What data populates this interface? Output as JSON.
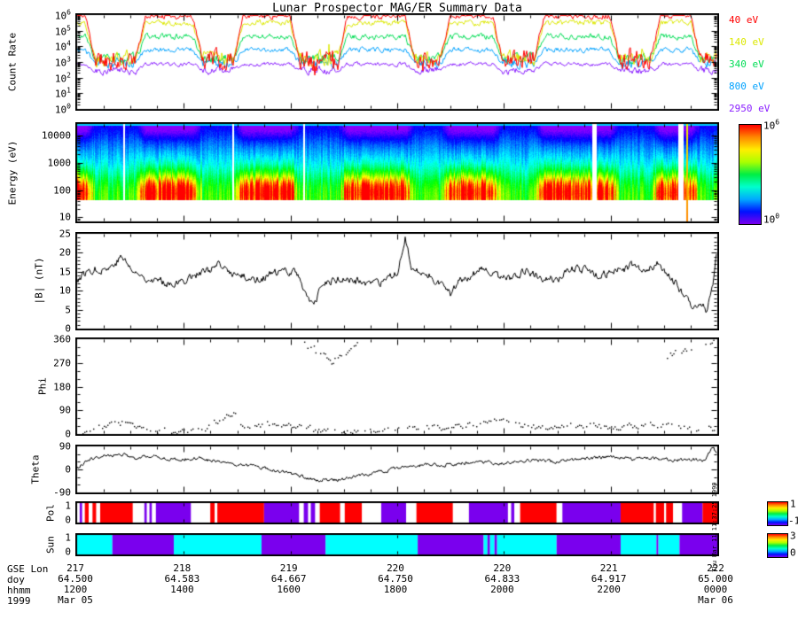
{
  "title": "Lunar Prospector MAG/ER Summary Data",
  "created_label": "Thu Mar 11 11:37:25 1999",
  "chart_data": {
    "type": "multi-panel time-series: log line plot, energy spectrogram (heatmap), line, scatter, line, categorical color bars",
    "time_axis": {
      "span": "1200 Mar 05 1999 to 0000 Mar 06 1999, major ticks every 2 hours",
      "tick_rows": [
        {
          "label": "GSE Lon",
          "values": [
            "217",
            "218",
            "219",
            "220",
            "220",
            "221",
            "222"
          ]
        },
        {
          "label": "doy",
          "values": [
            "64.500",
            "64.583",
            "64.667",
            "64.750",
            "64.833",
            "64.917",
            "65.000"
          ]
        },
        {
          "label": "hhmm",
          "values": [
            "1200",
            "1400",
            "1600",
            "1800",
            "2000",
            "2200",
            "0000"
          ]
        },
        {
          "label": "1999",
          "values": [
            "Mar 05",
            "",
            "",
            "",
            "",
            "",
            "Mar 06"
          ]
        }
      ]
    },
    "panels": [
      {
        "name": "count_rate",
        "ylabel": "Count Rate",
        "scale": "log",
        "ylim_log10": [
          0,
          6
        ],
        "ytick_labels": [
          "10^0",
          "10^1",
          "10^2",
          "10^3",
          "10^4",
          "10^5",
          "10^6"
        ],
        "dips": [
          [
            0.028,
            0.092
          ],
          [
            0.196,
            0.245
          ],
          [
            0.348,
            0.408
          ],
          [
            0.528,
            0.568
          ],
          [
            0.665,
            0.715
          ],
          [
            0.848,
            0.898
          ],
          [
            0.975,
            1.01
          ]
        ],
        "series": [
          {
            "label": "40 eV",
            "color": "#ff0000",
            "plateau_log10": 5.95,
            "dip_log10": 3.15,
            "noise": 0.16,
            "noise_dip": 0.5,
            "spiky": true,
            "seed": 11
          },
          {
            "label": "140 eV",
            "color": "#dce800",
            "plateau_log10": 5.5,
            "dip_log10": 3.25,
            "noise": 0.15,
            "noise_dip": 0.34,
            "spiky": true,
            "seed": 22
          },
          {
            "label": "340 eV",
            "color": "#00dd55",
            "plateau_log10": 4.62,
            "dip_log10": 3.2,
            "noise": 0.15,
            "noise_dip": 0.26,
            "spiky": false,
            "seed": 33
          },
          {
            "label": "800 eV",
            "color": "#00a2ff",
            "plateau_log10": 3.78,
            "dip_log10": 2.95,
            "noise": 0.13,
            "noise_dip": 0.26,
            "spiky": false,
            "seed": 44
          },
          {
            "label": "2950 eV",
            "color": "#8a1fff",
            "plateau_log10": 2.87,
            "dip_log10": 2.45,
            "noise": 0.1,
            "noise_dip": 0.2,
            "spiky": false,
            "seed": 55
          }
        ]
      },
      {
        "name": "energy_spectrogram",
        "ylabel": "Energy (eV)",
        "scale": "log",
        "ylim_log10": [
          0.85,
          4.42
        ],
        "ytick_labels": [
          "10000",
          "1000",
          "100",
          "10"
        ],
        "ytick_log10": [
          4,
          3,
          2,
          1
        ],
        "flux_peak_log10_energy": 1.95,
        "low_energy_cutoff_log10": 1.62,
        "white_gaps": [
          [
            0.072,
            2
          ],
          [
            0.243,
            2
          ],
          [
            0.354,
            2
          ],
          [
            0.806,
            5
          ],
          [
            0.941,
            6
          ]
        ],
        "yellow_line_t": 0.953,
        "colorbar": {
          "top_label": "10^6",
          "bottom_label": "10^0"
        },
        "seed": 7
      },
      {
        "name": "b_magnitude",
        "ylabel": "|B| (nT)",
        "ylim": [
          0,
          25
        ],
        "ytick_labels": [
          "0",
          "5",
          "10",
          "15",
          "20",
          "25"
        ],
        "noise": 0.9,
        "seed": 77,
        "points": [
          [
            0,
            13
          ],
          [
            0.02,
            15.5
          ],
          [
            0.05,
            16
          ],
          [
            0.07,
            19
          ],
          [
            0.09,
            14.5
          ],
          [
            0.11,
            13.5
          ],
          [
            0.13,
            12.5
          ],
          [
            0.16,
            12
          ],
          [
            0.18,
            14
          ],
          [
            0.2,
            15
          ],
          [
            0.22,
            16.5
          ],
          [
            0.25,
            14
          ],
          [
            0.28,
            13
          ],
          [
            0.31,
            14.5
          ],
          [
            0.34,
            15.5
          ],
          [
            0.36,
            9
          ],
          [
            0.37,
            5.5
          ],
          [
            0.385,
            12
          ],
          [
            0.41,
            13
          ],
          [
            0.44,
            12.5
          ],
          [
            0.46,
            11.5
          ],
          [
            0.48,
            12
          ],
          [
            0.5,
            14.5
          ],
          [
            0.513,
            24.5
          ],
          [
            0.525,
            15
          ],
          [
            0.55,
            14
          ],
          [
            0.57,
            12
          ],
          [
            0.585,
            8.5
          ],
          [
            0.6,
            13
          ],
          [
            0.63,
            15.5
          ],
          [
            0.65,
            14
          ],
          [
            0.68,
            13
          ],
          [
            0.7,
            15.5
          ],
          [
            0.72,
            14
          ],
          [
            0.75,
            13
          ],
          [
            0.78,
            16
          ],
          [
            0.8,
            15
          ],
          [
            0.82,
            14
          ],
          [
            0.85,
            15.5
          ],
          [
            0.87,
            16.5
          ],
          [
            0.89,
            15
          ],
          [
            0.91,
            17.5
          ],
          [
            0.93,
            13
          ],
          [
            0.95,
            9
          ],
          [
            0.965,
            5
          ],
          [
            0.975,
            7.5
          ],
          [
            0.985,
            4.5
          ],
          [
            0.995,
            13
          ],
          [
            1,
            20
          ]
        ]
      },
      {
        "name": "phi",
        "ylabel": "Phi",
        "ylim": [
          0,
          360
        ],
        "ytick_labels": [
          "0",
          "90",
          "180",
          "270",
          "360"
        ],
        "dot_noise": 10,
        "seed": 99,
        "low_band": [
          [
            0,
            15
          ],
          [
            0.04,
            30
          ],
          [
            0.07,
            45
          ],
          [
            0.1,
            20
          ],
          [
            0.15,
            10
          ],
          [
            0.2,
            15
          ],
          [
            0.243,
            88
          ],
          [
            0.26,
            25
          ],
          [
            0.29,
            30
          ],
          [
            0.32,
            45
          ],
          [
            0.35,
            30
          ],
          [
            0.38,
            12
          ],
          [
            0.42,
            10
          ],
          [
            0.46,
            15
          ],
          [
            0.5,
            20
          ],
          [
            0.55,
            25
          ],
          [
            0.6,
            30
          ],
          [
            0.64,
            55
          ],
          [
            0.68,
            40
          ],
          [
            0.72,
            25
          ],
          [
            0.76,
            30
          ],
          [
            0.8,
            35
          ],
          [
            0.84,
            25
          ],
          [
            0.88,
            30
          ],
          [
            0.92,
            35
          ],
          [
            0.96,
            25
          ],
          [
            1,
            15
          ]
        ],
        "clusters": [
          {
            "spread": 12,
            "points": [
              [
                0.355,
                345
              ],
              [
                0.368,
                330
              ],
              [
                0.382,
                305
              ],
              [
                0.398,
                278
              ],
              [
                0.415,
                295
              ],
              [
                0.428,
                330
              ],
              [
                0.44,
                352
              ]
            ]
          },
          {
            "spread": 16,
            "points": [
              [
                0.915,
                295
              ],
              [
                0.935,
                310
              ],
              [
                0.955,
                325
              ],
              [
                0.975,
                340
              ],
              [
                0.995,
                355
              ]
            ]
          }
        ]
      },
      {
        "name": "theta",
        "ylabel": "Theta",
        "ylim": [
          -90,
          90
        ],
        "ytick_labels": [
          "-90",
          "0",
          "90"
        ],
        "noise": 6,
        "seed": 120,
        "points": [
          [
            0,
            5
          ],
          [
            0.02,
            40
          ],
          [
            0.05,
            55
          ],
          [
            0.07,
            60
          ],
          [
            0.09,
            45
          ],
          [
            0.11,
            50
          ],
          [
            0.13,
            45
          ],
          [
            0.16,
            40
          ],
          [
            0.19,
            45
          ],
          [
            0.22,
            30
          ],
          [
            0.25,
            20
          ],
          [
            0.28,
            10
          ],
          [
            0.31,
            -5
          ],
          [
            0.34,
            -20
          ],
          [
            0.37,
            -40
          ],
          [
            0.4,
            -45
          ],
          [
            0.43,
            -30
          ],
          [
            0.46,
            -15
          ],
          [
            0.49,
            0
          ],
          [
            0.52,
            10
          ],
          [
            0.55,
            20
          ],
          [
            0.57,
            15
          ],
          [
            0.6,
            25
          ],
          [
            0.63,
            30
          ],
          [
            0.66,
            20
          ],
          [
            0.69,
            30
          ],
          [
            0.72,
            35
          ],
          [
            0.75,
            30
          ],
          [
            0.78,
            40
          ],
          [
            0.81,
            45
          ],
          [
            0.84,
            50
          ],
          [
            0.87,
            40
          ],
          [
            0.9,
            45
          ],
          [
            0.93,
            35
          ],
          [
            0.96,
            40
          ],
          [
            0.98,
            35
          ],
          [
            0.995,
            85
          ],
          [
            1,
            60
          ]
        ]
      },
      {
        "name": "pol",
        "ylabel": "Pol",
        "ytick_labels": [
          "0",
          "1"
        ],
        "colorbar": {
          "top_label": "1",
          "bottom_label": "-1"
        },
        "colors": {
          "R": "#ff0000",
          "P": "#7a00ee",
          "W": "#ffffff"
        },
        "segments": [
          [
            0,
            0.004,
            "W"
          ],
          [
            0.004,
            0.008,
            "P"
          ],
          [
            0.008,
            0.012,
            "W"
          ],
          [
            0.012,
            0.018,
            "R"
          ],
          [
            0.018,
            0.024,
            "W"
          ],
          [
            0.024,
            0.03,
            "R"
          ],
          [
            0.03,
            0.036,
            "W"
          ],
          [
            0.036,
            0.087,
            "R"
          ],
          [
            0.087,
            0.105,
            "W"
          ],
          [
            0.105,
            0.109,
            "P"
          ],
          [
            0.109,
            0.113,
            "W"
          ],
          [
            0.113,
            0.117,
            "P"
          ],
          [
            0.117,
            0.123,
            "W"
          ],
          [
            0.123,
            0.178,
            "P"
          ],
          [
            0.178,
            0.208,
            "W"
          ],
          [
            0.208,
            0.215,
            "R"
          ],
          [
            0.215,
            0.219,
            "W"
          ],
          [
            0.219,
            0.292,
            "R"
          ],
          [
            0.292,
            0.347,
            "P"
          ],
          [
            0.347,
            0.354,
            "W"
          ],
          [
            0.354,
            0.361,
            "P"
          ],
          [
            0.361,
            0.365,
            "W"
          ],
          [
            0.365,
            0.372,
            "P"
          ],
          [
            0.372,
            0.379,
            "W"
          ],
          [
            0.379,
            0.411,
            "R"
          ],
          [
            0.411,
            0.418,
            "W"
          ],
          [
            0.418,
            0.445,
            "R"
          ],
          [
            0.445,
            0.475,
            "W"
          ],
          [
            0.475,
            0.514,
            "P"
          ],
          [
            0.514,
            0.53,
            "W"
          ],
          [
            0.53,
            0.587,
            "R"
          ],
          [
            0.587,
            0.612,
            "W"
          ],
          [
            0.612,
            0.673,
            "P"
          ],
          [
            0.673,
            0.678,
            "W"
          ],
          [
            0.678,
            0.683,
            "P"
          ],
          [
            0.683,
            0.692,
            "W"
          ],
          [
            0.692,
            0.749,
            "R"
          ],
          [
            0.749,
            0.758,
            "W"
          ],
          [
            0.758,
            0.849,
            "P"
          ],
          [
            0.849,
            0.901,
            "R"
          ],
          [
            0.901,
            0.904,
            "W"
          ],
          [
            0.904,
            0.917,
            "R"
          ],
          [
            0.917,
            0.92,
            "W"
          ],
          [
            0.92,
            0.931,
            "R"
          ],
          [
            0.931,
            0.945,
            "W"
          ],
          [
            0.945,
            0.977,
            "P"
          ],
          [
            0.977,
            1,
            "R"
          ]
        ]
      },
      {
        "name": "sun",
        "ylabel": "Sun",
        "ytick_labels": [
          "0",
          "1"
        ],
        "colorbar": {
          "top_label": "3",
          "bottom_label": "0"
        },
        "colors": {
          "C": "#00ffff",
          "P": "#7a00ee"
        },
        "segments": [
          [
            0,
            0.055,
            "C"
          ],
          [
            0.055,
            0.151,
            "P"
          ],
          [
            0.151,
            0.288,
            "C"
          ],
          [
            0.288,
            0.388,
            "P"
          ],
          [
            0.388,
            0.532,
            "C"
          ],
          [
            0.532,
            0.635,
            "P"
          ],
          [
            0.635,
            0.641,
            "C"
          ],
          [
            0.641,
            0.645,
            "P"
          ],
          [
            0.645,
            0.652,
            "C"
          ],
          [
            0.652,
            0.656,
            "P"
          ],
          [
            0.656,
            0.749,
            "C"
          ],
          [
            0.749,
            0.849,
            "P"
          ],
          [
            0.849,
            0.905,
            "C"
          ],
          [
            0.905,
            0.908,
            "P"
          ],
          [
            0.908,
            0.941,
            "C"
          ],
          [
            0.941,
            1,
            "P"
          ]
        ]
      }
    ]
  }
}
